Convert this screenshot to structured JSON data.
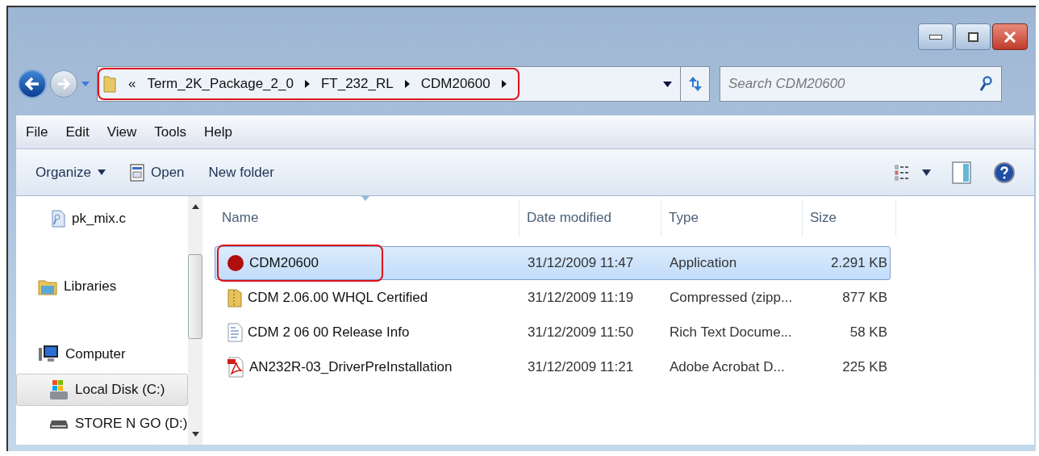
{
  "address_bar": {
    "overflow": "«",
    "segments": [
      "Term_2K_Package_2_0",
      "FT_232_RL",
      "CDM20600"
    ],
    "highlighted": true
  },
  "search": {
    "placeholder": "Search CDM20600"
  },
  "menu": [
    "File",
    "Edit",
    "View",
    "Tools",
    "Help"
  ],
  "toolbar": [
    {
      "label": "Organize",
      "kind": "dropdown"
    },
    {
      "label": "Open",
      "kind": "open"
    },
    {
      "label": "New folder",
      "kind": "plain"
    }
  ],
  "sidebar": {
    "items": [
      {
        "label": "pk_mix.c",
        "kind": "file",
        "selected": false
      },
      {
        "label": "Libraries",
        "kind": "libraries",
        "selected": false
      },
      {
        "label": "Computer",
        "kind": "computer",
        "selected": false
      },
      {
        "label": "Local Disk (C:)",
        "kind": "disk",
        "selected": true
      },
      {
        "label": "STORE N GO (D:)",
        "kind": "drive",
        "selected": false
      }
    ]
  },
  "table": {
    "columns": [
      "Name",
      "Date modified",
      "Type",
      "Size"
    ],
    "rows": [
      {
        "kind": "application",
        "name": "CDM20600",
        "date": "31/12/2009 11:47",
        "type": "Application",
        "size": "2.291 KB",
        "selected": true,
        "highlighted": true
      },
      {
        "kind": "zip",
        "name": "CDM 2.06.00 WHQL Certified",
        "date": "31/12/2009 11:19",
        "type": "Compressed (zipp...",
        "size": "877 KB",
        "selected": false,
        "highlighted": false
      },
      {
        "kind": "rtf",
        "name": "CDM 2 06 00 Release Info",
        "date": "31/12/2009 11:50",
        "type": "Rich Text Docume...",
        "size": "58 KB",
        "selected": false,
        "highlighted": false
      },
      {
        "kind": "pdf",
        "name": "AN232R-03_DriverPreInstallation",
        "date": "31/12/2009 11:21",
        "type": "Adobe Acrobat D...",
        "size": "225 KB",
        "selected": false,
        "highlighted": false
      }
    ]
  }
}
